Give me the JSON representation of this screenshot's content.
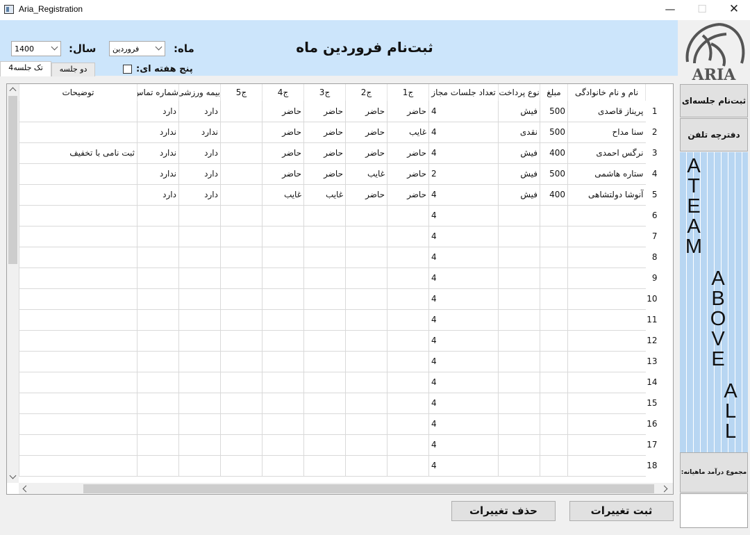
{
  "window": {
    "title": "Aria_Registration"
  },
  "logo": {
    "text": "ARIA"
  },
  "header": {
    "form_title": "ثبت‌نام فروردین ماه",
    "month_label": "ماه:",
    "month_value": "فروردین",
    "year_label": "سال:",
    "year_value": "1400",
    "five_week_label": "پنج هفته ای:",
    "tabs": [
      {
        "label": "تک جلسه4"
      },
      {
        "label": "دو جلسه"
      }
    ]
  },
  "table": {
    "columns": [
      "نام و نام خانوادگی",
      "مبلغ",
      "نوع پرداخت",
      "تعداد جلسات مجاز",
      "ج1",
      "ج2",
      "ج3",
      "ج4",
      "ج5",
      "بیمه ورزشی",
      "شماره تماس",
      "توضیحات"
    ],
    "rows": [
      {
        "no": "1",
        "name": "پریناز قاصدی",
        "amount": "500",
        "payment": "فیش",
        "sessions": "4",
        "s1": "حاضر",
        "s2": "حاضر",
        "s3": "حاضر",
        "s4": "حاضر",
        "s5": "",
        "insurance": "دارد",
        "phone": "دارد",
        "notes": ""
      },
      {
        "no": "2",
        "name": "سنا مداح",
        "amount": "500",
        "payment": "نقدی",
        "sessions": "4",
        "s1": "غایب",
        "s2": "حاضر",
        "s3": "حاضر",
        "s4": "حاضر",
        "s5": "",
        "insurance": "ندارد",
        "phone": "ندارد",
        "notes": ""
      },
      {
        "no": "3",
        "name": "نرگس احمدی",
        "amount": "400",
        "payment": "فیش",
        "sessions": "4",
        "s1": "حاضر",
        "s2": "حاضر",
        "s3": "حاضر",
        "s4": "حاضر",
        "s5": "",
        "insurance": "دارد",
        "phone": "ندارد",
        "notes": "ثبت نامی با تخفیف"
      },
      {
        "no": "4",
        "name": "ستاره هاشمی",
        "amount": "500",
        "payment": "فیش",
        "sessions": "2",
        "s1": "حاضر",
        "s2": "غایب",
        "s3": "حاضر",
        "s4": "حاضر",
        "s5": "",
        "insurance": "دارد",
        "phone": "ندارد",
        "notes": ""
      },
      {
        "no": "5",
        "name": "آنوشا دولتشاهی",
        "amount": "400",
        "payment": "فیش",
        "sessions": "4",
        "s1": "حاضر",
        "s2": "حاضر",
        "s3": "غایب",
        "s4": "غایب",
        "s5": "",
        "insurance": "دارد",
        "phone": "دارد",
        "notes": ""
      },
      {
        "no": "6",
        "name": "",
        "amount": "",
        "payment": "",
        "sessions": "4",
        "s1": "",
        "s2": "",
        "s3": "",
        "s4": "",
        "s5": "",
        "insurance": "",
        "phone": "",
        "notes": ""
      },
      {
        "no": "7",
        "name": "",
        "amount": "",
        "payment": "",
        "sessions": "4",
        "s1": "",
        "s2": "",
        "s3": "",
        "s4": "",
        "s5": "",
        "insurance": "",
        "phone": "",
        "notes": ""
      },
      {
        "no": "8",
        "name": "",
        "amount": "",
        "payment": "",
        "sessions": "4",
        "s1": "",
        "s2": "",
        "s3": "",
        "s4": "",
        "s5": "",
        "insurance": "",
        "phone": "",
        "notes": ""
      },
      {
        "no": "9",
        "name": "",
        "amount": "",
        "payment": "",
        "sessions": "4",
        "s1": "",
        "s2": "",
        "s3": "",
        "s4": "",
        "s5": "",
        "insurance": "",
        "phone": "",
        "notes": ""
      },
      {
        "no": "10",
        "name": "",
        "amount": "",
        "payment": "",
        "sessions": "4",
        "s1": "",
        "s2": "",
        "s3": "",
        "s4": "",
        "s5": "",
        "insurance": "",
        "phone": "",
        "notes": ""
      },
      {
        "no": "11",
        "name": "",
        "amount": "",
        "payment": "",
        "sessions": "4",
        "s1": "",
        "s2": "",
        "s3": "",
        "s4": "",
        "s5": "",
        "insurance": "",
        "phone": "",
        "notes": ""
      },
      {
        "no": "12",
        "name": "",
        "amount": "",
        "payment": "",
        "sessions": "4",
        "s1": "",
        "s2": "",
        "s3": "",
        "s4": "",
        "s5": "",
        "insurance": "",
        "phone": "",
        "notes": ""
      },
      {
        "no": "13",
        "name": "",
        "amount": "",
        "payment": "",
        "sessions": "4",
        "s1": "",
        "s2": "",
        "s3": "",
        "s4": "",
        "s5": "",
        "insurance": "",
        "phone": "",
        "notes": ""
      },
      {
        "no": "14",
        "name": "",
        "amount": "",
        "payment": "",
        "sessions": "4",
        "s1": "",
        "s2": "",
        "s3": "",
        "s4": "",
        "s5": "",
        "insurance": "",
        "phone": "",
        "notes": ""
      },
      {
        "no": "15",
        "name": "",
        "amount": "",
        "payment": "",
        "sessions": "4",
        "s1": "",
        "s2": "",
        "s3": "",
        "s4": "",
        "s5": "",
        "insurance": "",
        "phone": "",
        "notes": ""
      },
      {
        "no": "16",
        "name": "",
        "amount": "",
        "payment": "",
        "sessions": "4",
        "s1": "",
        "s2": "",
        "s3": "",
        "s4": "",
        "s5": "",
        "insurance": "",
        "phone": "",
        "notes": ""
      },
      {
        "no": "17",
        "name": "",
        "amount": "",
        "payment": "",
        "sessions": "4",
        "s1": "",
        "s2": "",
        "s3": "",
        "s4": "",
        "s5": "",
        "insurance": "",
        "phone": "",
        "notes": ""
      },
      {
        "no": "18",
        "name": "",
        "amount": "",
        "payment": "",
        "sessions": "4",
        "s1": "",
        "s2": "",
        "s3": "",
        "s4": "",
        "s5": "",
        "insurance": "",
        "phone": "",
        "notes": ""
      }
    ]
  },
  "buttons": {
    "save_label": "ثبت تغییرات",
    "delete_label": "حذف تغییرات"
  },
  "right_panel": {
    "session_registration_label": "ثبت‌نام جلسه‌ای",
    "phonebook_label": "دفترچه تلفن",
    "slogan_1": "ATEAM",
    "slogan_2": "ABOVE",
    "slogan_3": "ALL",
    "monthly_income_label": "مجموع درآمد ماهیانه:",
    "monthly_income_value": ""
  },
  "colors": {
    "header_bg": "#cce5fb",
    "stripe": "#b8d6f2",
    "window_bg": "#f0f0f0"
  }
}
